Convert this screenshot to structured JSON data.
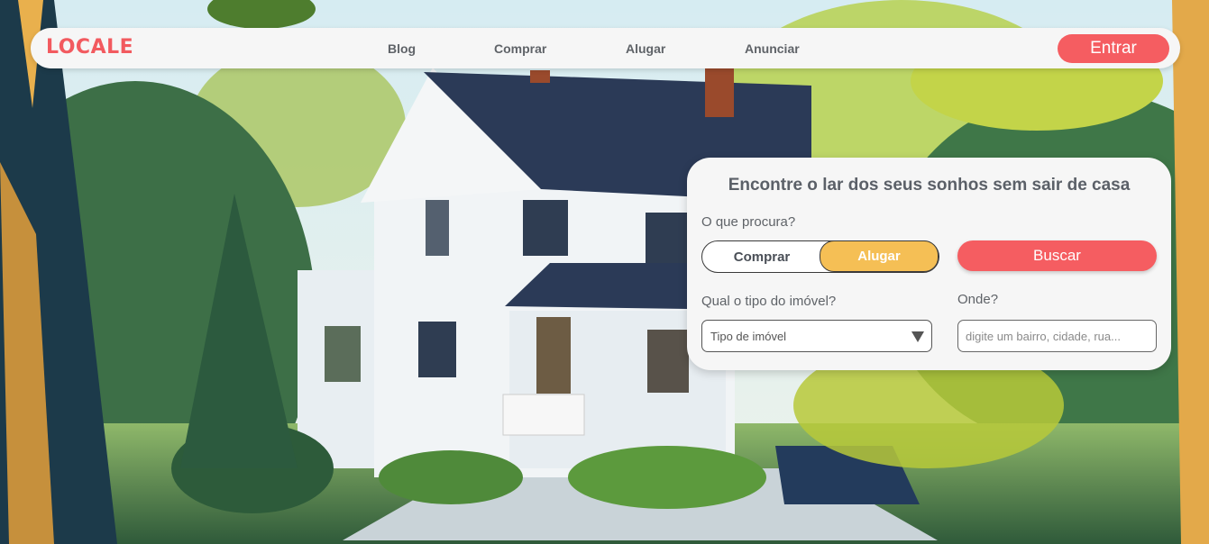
{
  "brand": {
    "logo_text": "LOCALE",
    "accent_color": "#f55d61",
    "highlight_color": "#f5bf55"
  },
  "nav": {
    "links": [
      "Blog",
      "Comprar",
      "Alugar",
      "Anunciar"
    ],
    "login_label": "Entrar"
  },
  "search": {
    "title": "Encontre o lar dos seus sonhos sem sair de casa",
    "what_label": "O que procura?",
    "toggle": {
      "options": [
        "Comprar",
        "Alugar"
      ],
      "selected": "Alugar"
    },
    "search_button_label": "Buscar",
    "type_label": "Qual o tipo do imóvel?",
    "type_select_value": "Tipo de imóvel",
    "where_label": "Onde?",
    "where_placeholder": "digite um bairro, cidade, rua..."
  },
  "background": {
    "scene": "illustrated-house-in-forest"
  }
}
